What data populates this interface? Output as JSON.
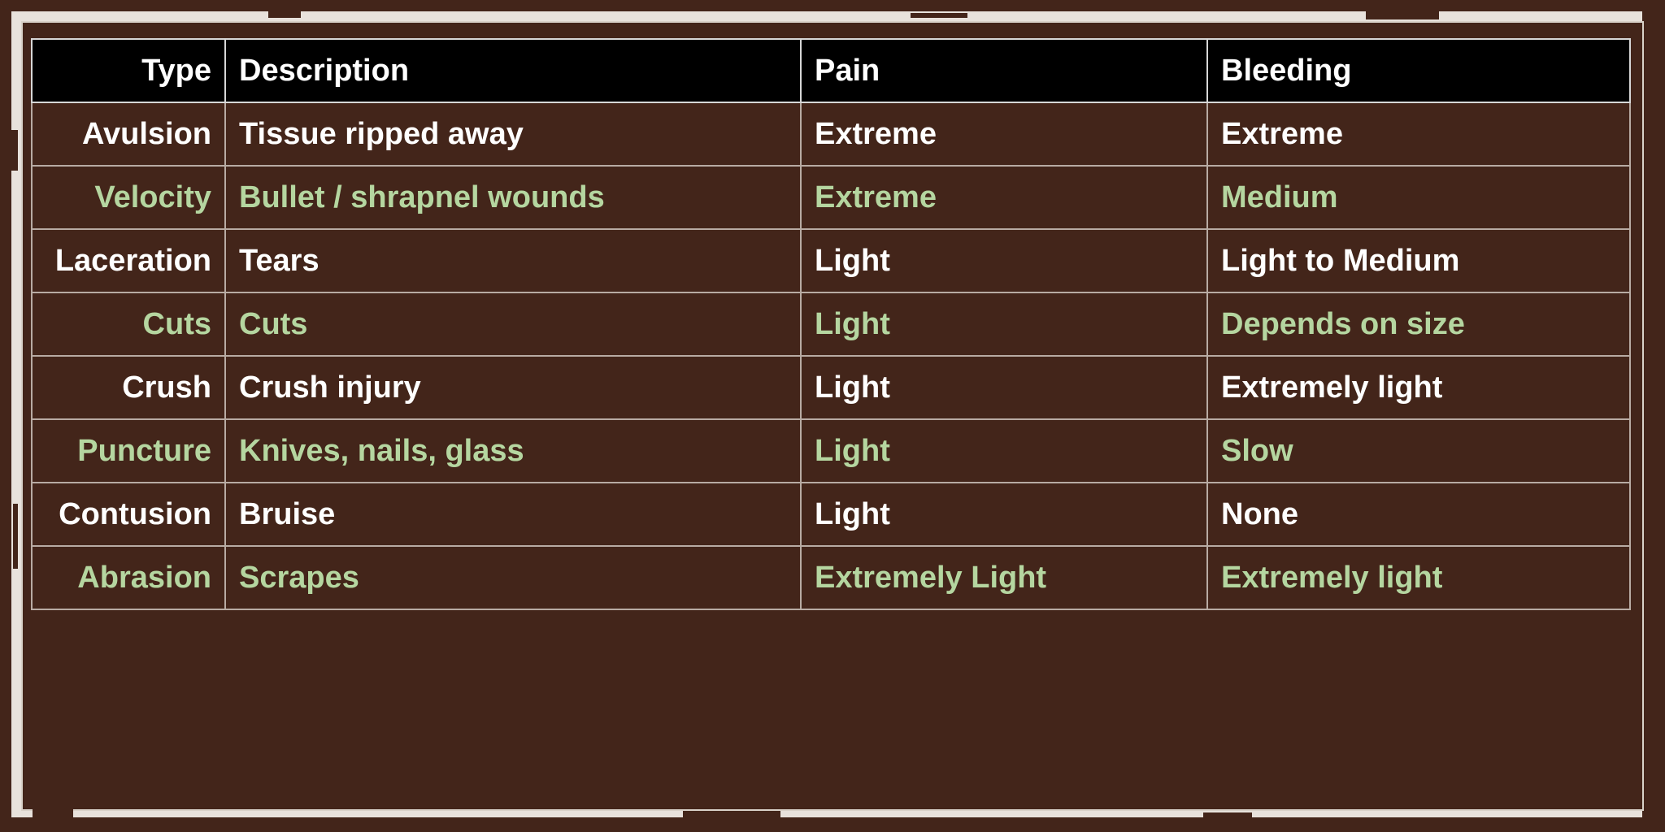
{
  "colors": {
    "background": "#43251a",
    "header_bg": "#000000",
    "row_text_white": "#ffffff",
    "row_text_green": "#b5d6a0",
    "frame": "#e8e2dc"
  },
  "table": {
    "headers": [
      "Type",
      "Description",
      "Pain",
      "Bleeding"
    ],
    "rows": [
      {
        "type": "Avulsion",
        "description": "Tissue ripped away",
        "pain": "Extreme",
        "bleeding": "Extreme",
        "style": "white"
      },
      {
        "type": "Velocity",
        "description": "Bullet / shrapnel wounds",
        "pain": "Extreme",
        "bleeding": "Medium",
        "style": "green"
      },
      {
        "type": "Laceration",
        "description": "Tears",
        "pain": "Light",
        "bleeding": "Light to Medium",
        "style": "white"
      },
      {
        "type": "Cuts",
        "description": "Cuts",
        "pain": "Light",
        "bleeding": "Depends on size",
        "style": "green"
      },
      {
        "type": "Crush",
        "description": "Crush injury",
        "pain": "Light",
        "bleeding": "Extremely light",
        "style": "white"
      },
      {
        "type": "Puncture",
        "description": "Knives, nails, glass",
        "pain": "Light",
        "bleeding": "Slow",
        "style": "green"
      },
      {
        "type": "Contusion",
        "description": "Bruise",
        "pain": "Light",
        "bleeding": "None",
        "style": "white"
      },
      {
        "type": "Abrasion",
        "description": "Scrapes",
        "pain": "Extremely Light",
        "bleeding": "Extremely light",
        "style": "green"
      }
    ]
  }
}
